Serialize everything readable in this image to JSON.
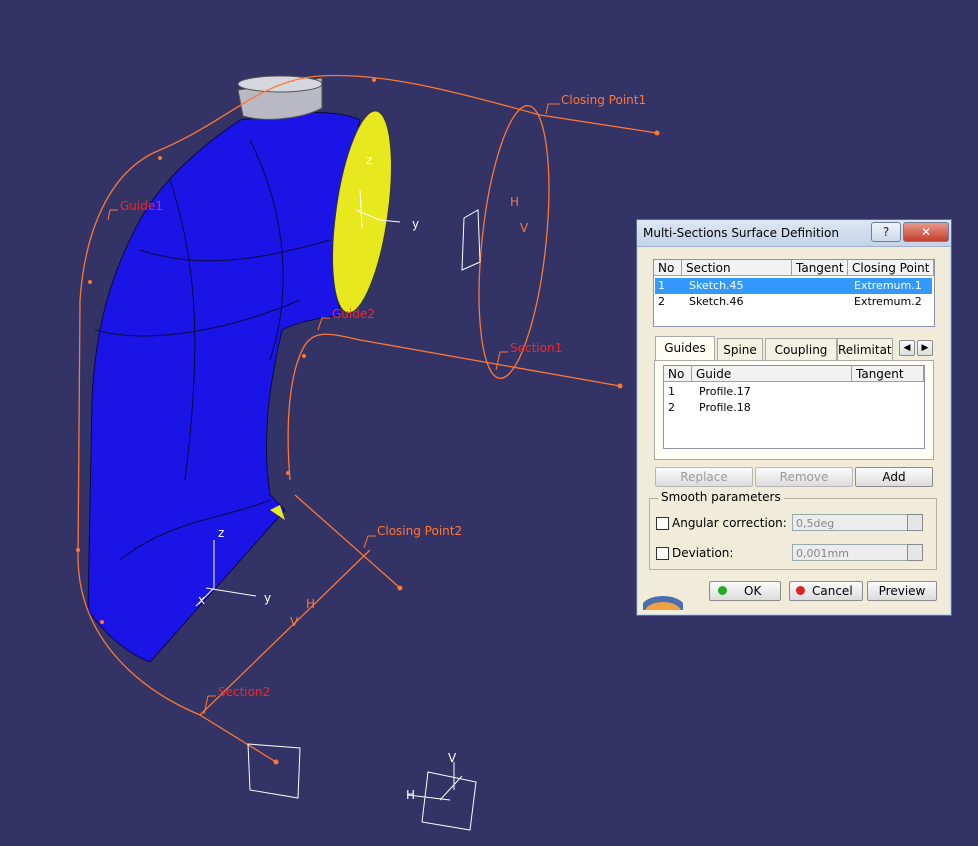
{
  "colors": {
    "background": "#333366",
    "body": "#1a14e6",
    "inner": "#e8e81e",
    "curve": "#ff7733",
    "label": "#ff2222",
    "selection": "#3399ff"
  },
  "scene": {
    "labels": {
      "closing_point1": "Closing Point1",
      "closing_point2": "Closing Point2",
      "guide1": "Guide1",
      "guide2": "Guide2",
      "section1": "Section1",
      "section2": "Section2"
    },
    "axes": {
      "z": "z",
      "y": "y",
      "x": "x",
      "h": "H",
      "v": "V"
    }
  },
  "dialog": {
    "title": "Multi-Sections Surface Definition",
    "help": "?",
    "close": "✕",
    "sections": {
      "headers": {
        "no": "No",
        "section": "Section",
        "tangent": "Tangent",
        "closing": "Closing Point"
      },
      "rows": [
        {
          "no": "1",
          "section": "Sketch.45",
          "tangent": "",
          "closing": "Extremum.1"
        },
        {
          "no": "2",
          "section": "Sketch.46",
          "tangent": "",
          "closing": "Extremum.2"
        }
      ]
    },
    "tabs": {
      "guides": "Guides",
      "spine": "Spine",
      "coupling": "Coupling",
      "relimitation": "Relimitati"
    },
    "guides": {
      "headers": {
        "no": "No",
        "guide": "Guide",
        "tangent": "Tangent"
      },
      "rows": [
        {
          "no": "1",
          "guide": "Profile.17"
        },
        {
          "no": "2",
          "guide": "Profile.18"
        }
      ]
    },
    "buttons": {
      "replace": "Replace",
      "remove": "Remove",
      "add": "Add"
    },
    "smooth": {
      "title": "Smooth parameters",
      "angular_label": "Angular correction:",
      "angular_value": "0,5deg",
      "deviation_label": "Deviation:",
      "deviation_value": "0,001mm"
    },
    "footer": {
      "ok": "OK",
      "cancel": "Cancel",
      "preview": "Preview"
    }
  }
}
